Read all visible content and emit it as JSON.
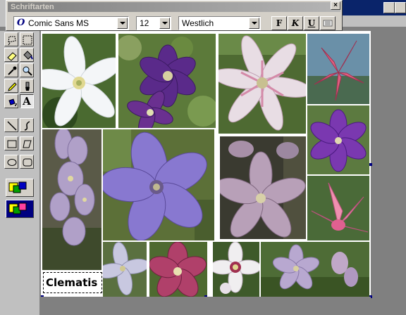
{
  "font_palette": {
    "title": "Schriftarten",
    "close_label": "×",
    "font_icon": "O",
    "font_name": "Comic Sans MS",
    "font_size": "12",
    "script": "Westlich",
    "bold_label": "F",
    "italic_label": "K",
    "underline_label": "U"
  },
  "tools": [
    {
      "name": "lasso-tool",
      "icon": "lasso-icon"
    },
    {
      "name": "select-rect-tool",
      "icon": "marquee-icon"
    },
    {
      "name": "eraser-tool",
      "icon": "eraser-icon"
    },
    {
      "name": "paint-bucket-tool",
      "icon": "bucket-icon"
    },
    {
      "name": "eyedropper-tool",
      "icon": "eyedropper-icon"
    },
    {
      "name": "zoom-tool",
      "icon": "magnifier-icon"
    },
    {
      "name": "pencil-tool",
      "icon": "pencil-icon"
    },
    {
      "name": "brush-tool",
      "icon": "brush-icon"
    },
    {
      "name": "airbrush-tool",
      "icon": "spray-icon"
    },
    {
      "name": "text-tool",
      "icon": "text-icon",
      "label": "A"
    },
    {
      "name": "line-tool",
      "icon": "line-icon"
    },
    {
      "name": "curve-tool",
      "icon": "curve-icon"
    },
    {
      "name": "rectangle-tool",
      "icon": "rectangle-icon"
    },
    {
      "name": "polygon-tool",
      "icon": "polygon-icon"
    },
    {
      "name": "ellipse-tool",
      "icon": "ellipse-icon"
    },
    {
      "name": "rounded-rect-tool",
      "icon": "rounded-rect-icon"
    }
  ],
  "canvas": {
    "caption": "Clematis"
  },
  "colors": {
    "title_bar": "#808080",
    "face": "#d4d0c8",
    "workspace": "#808080",
    "selection": "#000080"
  }
}
